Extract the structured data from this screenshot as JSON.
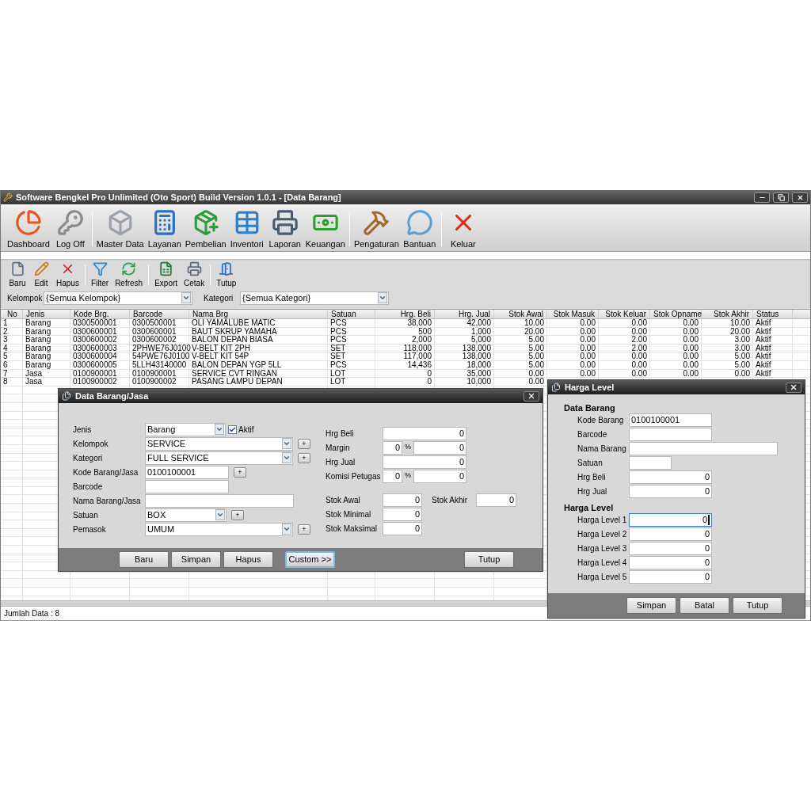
{
  "window": {
    "title": "Software Bengkel Pro Unlimited (Oto Sport) Build Version 1.0.1 - [Data Barang]"
  },
  "main_toolbar": [
    {
      "buttons": [
        {
          "label": "Dashboard"
        },
        {
          "label": "Log Off"
        }
      ]
    },
    {
      "buttons": [
        {
          "label": "Master Data"
        },
        {
          "label": "Layanan"
        },
        {
          "label": "Pembelian"
        },
        {
          "label": "Inventori"
        },
        {
          "label": "Laporan"
        },
        {
          "label": "Keuangan"
        }
      ]
    },
    {
      "buttons": [
        {
          "label": "Pengaturan"
        },
        {
          "label": "Bantuan"
        }
      ]
    },
    {
      "buttons": [
        {
          "label": "Keluar"
        }
      ]
    }
  ],
  "sub_toolbar": [
    {
      "buttons": [
        {
          "label": "Baru"
        },
        {
          "label": "Edit"
        },
        {
          "label": "Hapus"
        }
      ]
    },
    {
      "buttons": [
        {
          "label": "Filter"
        },
        {
          "label": "Refresh"
        }
      ]
    },
    {
      "buttons": [
        {
          "label": "Export"
        },
        {
          "label": "Cetak"
        }
      ]
    },
    {
      "buttons": [
        {
          "label": "Tutup"
        }
      ]
    }
  ],
  "filters": [
    {
      "label": "Kelompok",
      "value": "{Semua Kelompok}"
    },
    {
      "label": "Kategori",
      "value": "{Semua Kategori}"
    }
  ],
  "table": {
    "columns": [
      "No",
      "Jenis",
      "Kode Brg.",
      "Barcode",
      "Nama Brg",
      "Satuan",
      "Hrg. Beli",
      "Hrg. Jual",
      "Stok Awal",
      "Stok Masuk",
      "Stok Keluar",
      "Stok Opname",
      "Stok Akhir",
      "Status"
    ],
    "rows": [
      [
        "1",
        "Barang",
        "0300500001",
        "0300500001",
        "OLI YAMALUBE MATIC",
        "PCS",
        "38,000",
        "42,000",
        "10.00",
        "0.00",
        "0.00",
        "0.00",
        "10.00",
        "Aktif"
      ],
      [
        "2",
        "Barang",
        "0300600001",
        "0300600001",
        "BAUT SKRUP YAMAHA",
        "PCS",
        "500",
        "1,000",
        "20.00",
        "0.00",
        "0.00",
        "0.00",
        "20.00",
        "Aktif"
      ],
      [
        "3",
        "Barang",
        "0300600002",
        "0300600002",
        "BALON DEPAN BIASA",
        "PCS",
        "2,000",
        "5,000",
        "5.00",
        "0.00",
        "2.00",
        "0.00",
        "3.00",
        "Aktif"
      ],
      [
        "4",
        "Barang",
        "0300600003",
        "2PHWE76J0100",
        "V-BELT KIT 2PH",
        "SET",
        "118,000",
        "138,000",
        "5.00",
        "0.00",
        "2.00",
        "0.00",
        "3.00",
        "Aktif"
      ],
      [
        "5",
        "Barang",
        "0300600004",
        "54PWE76J0100",
        "V-BELT KIT 54P",
        "SET",
        "117,000",
        "138,000",
        "5.00",
        "0.00",
        "0.00",
        "0.00",
        "5.00",
        "Aktif"
      ],
      [
        "6",
        "Barang",
        "0300600005",
        "5LLH43140000",
        "BALON DEPAN YGP 5LL",
        "PCS",
        "14,436",
        "18,000",
        "5.00",
        "0.00",
        "0.00",
        "0.00",
        "5.00",
        "Aktif"
      ],
      [
        "7",
        "Jasa",
        "0100900001",
        "0100900001",
        "SERVICE CVT RINGAN",
        "LOT",
        "0",
        "35,000",
        "0.00",
        "0.00",
        "0.00",
        "0.00",
        "0.00",
        "Aktif"
      ],
      [
        "8",
        "Jasa",
        "0100900002",
        "0100900002",
        "PASANG LAMPU DEPAN",
        "LOT",
        "0",
        "10,000",
        "0.00"
      ]
    ]
  },
  "status_bar": "Jumlah Data : 8",
  "item_dialog": {
    "title": "Data Barang/Jasa",
    "left_fields": [
      {
        "label": "Jenis",
        "kind": "select",
        "value": "Barang",
        "checkbox": {
          "label": "Aktif",
          "checked": true
        }
      },
      {
        "label": "Kelompok",
        "kind": "select",
        "value": "SERVICE",
        "add": "+"
      },
      {
        "label": "Kategori",
        "kind": "select",
        "value": "FULL SERVICE",
        "add": "+"
      },
      {
        "label": "Kode Barang/Jasa",
        "kind": "text",
        "value": "0100100001",
        "add": "+"
      },
      {
        "label": "Barcode",
        "kind": "text"
      },
      {
        "label": "Nama Barang/Jasa",
        "kind": "text"
      },
      {
        "label": "Satuan",
        "kind": "select",
        "value": "BOX",
        "add": "+"
      },
      {
        "label": "Pemasok",
        "kind": "select",
        "value": "UMUM",
        "add": "+"
      }
    ],
    "price_fields": [
      {
        "label": "Hrg Beli",
        "kind": "single",
        "value": "0"
      },
      {
        "label": "Margin",
        "kind": "percent",
        "percent": "0",
        "unit": "%",
        "value": "0"
      },
      {
        "label": "Hrg Jual",
        "kind": "single",
        "value": "0"
      },
      {
        "label": "Komisi Petugas",
        "kind": "percent",
        "percent": "0",
        "unit": "%",
        "value": "0"
      }
    ],
    "stock_fields": [
      {
        "label": "Stok Awal",
        "value": "0"
      },
      {
        "label": "Stok Minimal",
        "value": "0"
      },
      {
        "label": "Stok Maksimal",
        "value": "0"
      }
    ],
    "stock_end": {
      "label": "Stok Akhir",
      "value": "0"
    },
    "buttons": [
      {
        "label": "Baru",
        "focused": false
      },
      {
        "label": "Simpan",
        "focused": false
      },
      {
        "label": "Hapus",
        "focused": false
      },
      {
        "label": "Custom >>",
        "focused": true
      },
      {
        "label": "Tutup",
        "focused": false
      }
    ]
  },
  "price_level_dialog": {
    "title": "Harga Level",
    "sections": [
      {
        "heading": "Data Barang",
        "fields": [
          {
            "label": "Kode Barang",
            "value": "0100100001"
          },
          {
            "label": "Barcode"
          },
          {
            "label": "Nama Barang"
          },
          {
            "label": "Satuan"
          },
          {
            "label": "Hrg Beli",
            "value": "0"
          },
          {
            "label": "Hrg Jual",
            "value": "0"
          }
        ]
      },
      {
        "heading": "Harga Level",
        "fields": [
          {
            "label": "Harga Level 1",
            "value": "0",
            "focused": true
          },
          {
            "label": "Harga Level 2",
            "value": "0",
            "focused": false
          },
          {
            "label": "Harga Level 3",
            "value": "0",
            "focused": false
          },
          {
            "label": "Harga Level 4",
            "value": "0",
            "focused": false
          },
          {
            "label": "Harga Level 5",
            "value": "0",
            "focused": false
          }
        ]
      }
    ],
    "buttons": [
      {
        "label": "Simpan"
      },
      {
        "label": "Batal"
      },
      {
        "label": "Tutup"
      }
    ]
  }
}
